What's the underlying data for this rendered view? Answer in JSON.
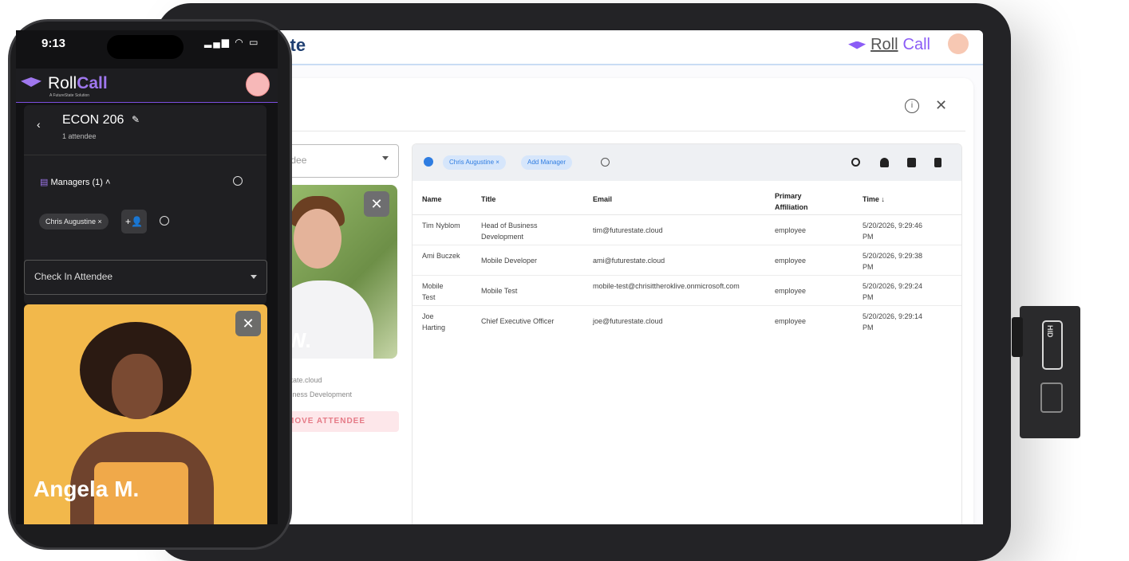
{
  "tablet": {
    "brand_partial": "tate",
    "logo": {
      "roll": "Roll",
      "call": "Call"
    },
    "close": "✕",
    "info": "i",
    "select_placeholder": "endee",
    "photo_name": "r W.",
    "photo_close": "✕",
    "attendee_email": "state.cloud",
    "attendee_title": "siness Development",
    "remove_button": "MOVE ATTENDEE",
    "toolbar": {
      "manager_chip": "Chris Augustine ×",
      "add_manager": "Add Manager"
    },
    "table": {
      "headers": [
        "Name",
        "Title",
        "Email",
        "Primary Affiliation",
        "Time ↓"
      ],
      "rows": [
        {
          "name": "Tim Nyblom",
          "title": "Head of Business Development",
          "email": "tim@futurestate.cloud",
          "affiliation": "employee",
          "time": "5/20/2026, 9:29:46 PM"
        },
        {
          "name": "Ami Buczek",
          "title": "Mobile Developer",
          "email": "ami@futurestate.cloud",
          "affiliation": "employee",
          "time": "5/20/2026, 9:29:38 PM"
        },
        {
          "name": "Mobile Test",
          "title": "Mobile Test",
          "email": "mobile-test@chrisittheroklive.onmicrosoft.com",
          "affiliation": "employee",
          "time": "5/20/2026, 9:29:24 PM"
        },
        {
          "name": "Joe Harting",
          "title": "Chief Executive Officer",
          "email": "joe@futurestate.cloud",
          "affiliation": "employee",
          "time": "5/20/2026, 9:29:14 PM"
        }
      ]
    }
  },
  "phone": {
    "time": "9:13",
    "status_icons": "▂▄▆ ◠ ▭",
    "brand": {
      "roll": "Roll",
      "call": "Call"
    },
    "brand_sub": "A FutureState Solution",
    "back": "‹",
    "course": "ECON 206",
    "edit": "✎",
    "attendee_count": "1 attendee",
    "managers_label": "Managers (1) ˄",
    "calendar_icon": "▤",
    "manager_chip": "Chris Augustine ×",
    "add_manager_icon": "+👤",
    "select_label": "Check In Attendee",
    "photo_name": "Angela M.",
    "photo_close": "✕"
  },
  "reader": {
    "label": "HID"
  },
  "colors": {
    "accent": "#8b5cf6",
    "blue": "#2f7de1",
    "photo_bg": "#f2b84b"
  }
}
